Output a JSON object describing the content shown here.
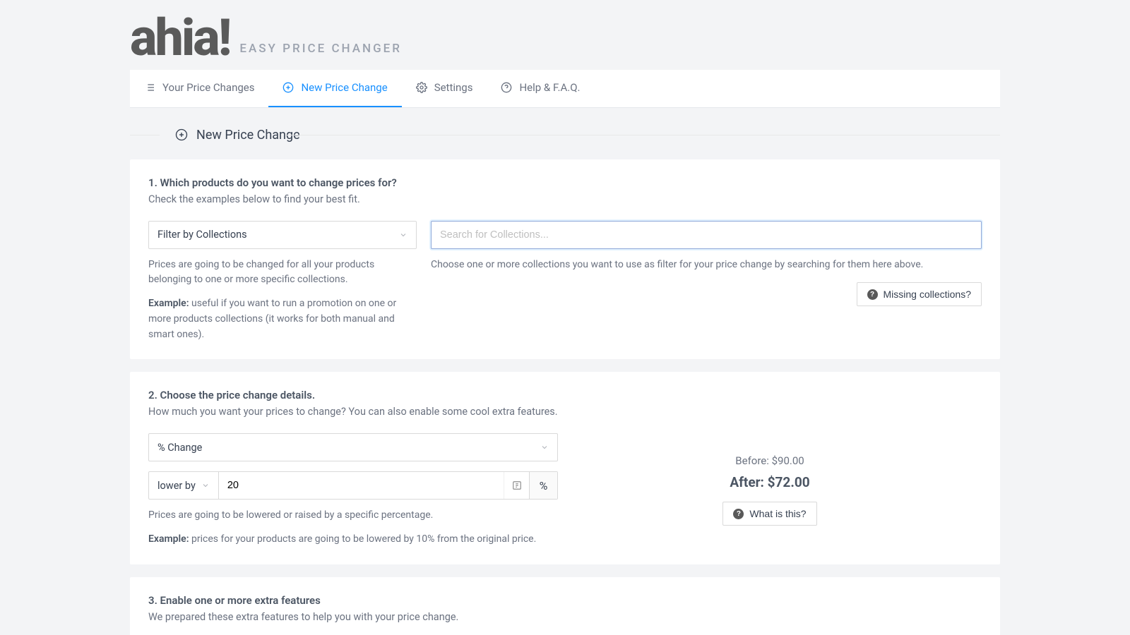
{
  "brand": {
    "name": "ahia!",
    "tagline": "EASY PRICE CHANGER"
  },
  "tabs": {
    "your_changes": "Your Price Changes",
    "new_change": "New Price Change",
    "settings": "Settings",
    "help": "Help & F.A.Q."
  },
  "page_title": "New Price Change",
  "section1": {
    "title": "1. Which products do you want to change prices for?",
    "subtitle": "Check the examples below to find your best fit.",
    "filter_label": "Filter by Collections",
    "search_placeholder": "Search for Collections...",
    "left_help1": "Prices are going to be changed for all your products belonging to one or more specific collections.",
    "example_label": "Example:",
    "left_help2": " useful if you want to run a promotion on one or more products collections (it works for both manual and smart ones).",
    "right_help": "Choose one or more collections you want to use as filter for your price change by searching for them here above.",
    "missing_btn": "Missing collections?"
  },
  "section2": {
    "title": "2. Choose the price change details.",
    "subtitle": "How much you want your prices to change? You can also enable some cool extra features.",
    "change_type_label": "% Change",
    "direction_label": "lower by",
    "amount_value": "20",
    "suffix": "%",
    "help1": "Prices are going to be lowered or raised by a specific percentage.",
    "example_label": "Example:",
    "help2": " prices for your products are going to be lowered by 10% from the original price.",
    "before_label": "Before: $90.00",
    "after_label": "After: $72.00",
    "what_btn": "What is this?"
  },
  "section3": {
    "title": "3. Enable one or more extra features",
    "subtitle": "We prepared these extra features to help you with your price change."
  }
}
